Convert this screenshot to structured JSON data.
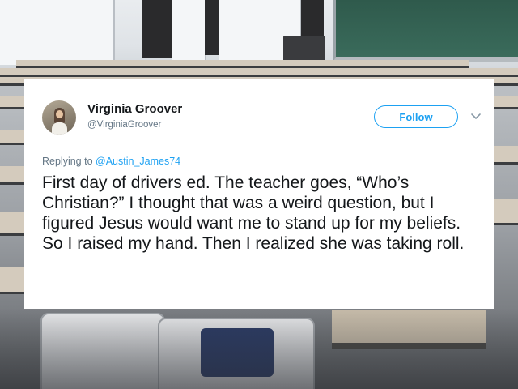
{
  "tweet": {
    "author": {
      "display_name": "Virginia Groover",
      "handle": "@VirginiaGroover"
    },
    "follow_label": "Follow",
    "reply_prefix": "Replying to ",
    "reply_to": "@Austin_James74",
    "text": "First day of drivers ed. The teacher goes, “Who’s Christian?” I thought that was a weird question, but I figured Jesus would want me to stand up for my beliefs. So I raised my hand. Then I realized she was taking roll."
  },
  "colors": {
    "accent": "#1da1f2",
    "text_primary": "#14171a",
    "text_secondary": "#657786",
    "card_background": "#ffffff"
  },
  "icons": {
    "more_options": "chevron-down-icon"
  }
}
